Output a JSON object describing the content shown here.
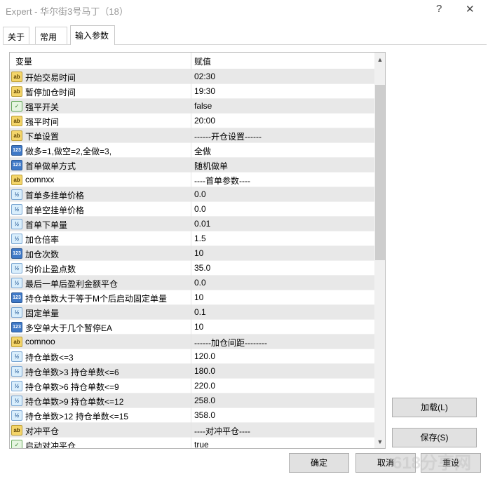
{
  "window": {
    "title": "Expert - 华尔街3号马丁（18）",
    "help_glyph": "?",
    "close_glyph": "✕"
  },
  "tabs": [
    {
      "label": "关于"
    },
    {
      "label": "常用"
    },
    {
      "label": "输入参数"
    }
  ],
  "table": {
    "header_var": "变量",
    "header_val": "赋值",
    "rows": [
      {
        "icon": "ab",
        "name": "开始交易时间",
        "value": "02:30"
      },
      {
        "icon": "ab",
        "name": "暂停加仓时间",
        "value": "19:30"
      },
      {
        "icon": "bool",
        "name": "强平开关",
        "value": "false"
      },
      {
        "icon": "ab",
        "name": "强平时间",
        "value": "20:00"
      },
      {
        "icon": "ab",
        "name": "下单设置",
        "value": "------开仓设置------"
      },
      {
        "icon": "123",
        "name": "做多=1,做空=2,全做=3,",
        "value": "全做"
      },
      {
        "icon": "123",
        "name": "首单做单方式",
        "value": "随机做单"
      },
      {
        "icon": "ab",
        "name": "comnxx",
        "value": "----首单参数----"
      },
      {
        "icon": "v2",
        "name": "首单多挂单价格",
        "value": "0.0"
      },
      {
        "icon": "v2",
        "name": "首单空挂单价格",
        "value": "0.0"
      },
      {
        "icon": "v2",
        "name": "首单下单量",
        "value": "0.01"
      },
      {
        "icon": "v2",
        "name": "加仓倍率",
        "value": "1.5"
      },
      {
        "icon": "123",
        "name": "加仓次数",
        "value": "10"
      },
      {
        "icon": "v2",
        "name": "均价止盈点数",
        "value": "35.0"
      },
      {
        "icon": "v2",
        "name": "最后一单后盈利金额平仓",
        "value": "0.0"
      },
      {
        "icon": "123",
        "name": "持仓单数大于等于M个后启动固定单量",
        "value": "10"
      },
      {
        "icon": "v2",
        "name": "固定单量",
        "value": "0.1"
      },
      {
        "icon": "123",
        "name": "多空单大于几个暂停EA",
        "value": "10"
      },
      {
        "icon": "ab",
        "name": "comnoo",
        "value": "------加仓间距--------"
      },
      {
        "icon": "v2",
        "name": "持仓单数<=3",
        "value": "120.0"
      },
      {
        "icon": "v2",
        "name": "持仓单数>3    持仓单数<=6",
        "value": "180.0"
      },
      {
        "icon": "v2",
        "name": "持仓单数>6    持仓单数<=9",
        "value": "220.0"
      },
      {
        "icon": "v2",
        "name": "持仓单数>9    持仓单数<=12",
        "value": "258.0"
      },
      {
        "icon": "v2",
        "name": "持仓单数>12  持仓单数<=15",
        "value": "358.0"
      },
      {
        "icon": "ab",
        "name": "对冲平仓",
        "value": "----对冲平仓----"
      },
      {
        "icon": "bool",
        "name": "启动对冲平仓",
        "value": "true"
      }
    ]
  },
  "icon_labels": {
    "ab": "ab",
    "123": "123",
    "v2": "½",
    "bool": "✓"
  },
  "buttons": {
    "load": "加载(L)",
    "save": "保存(S)",
    "ok": "确定",
    "cancel": "取消",
    "reset": "重设"
  },
  "watermark": "618分享网"
}
